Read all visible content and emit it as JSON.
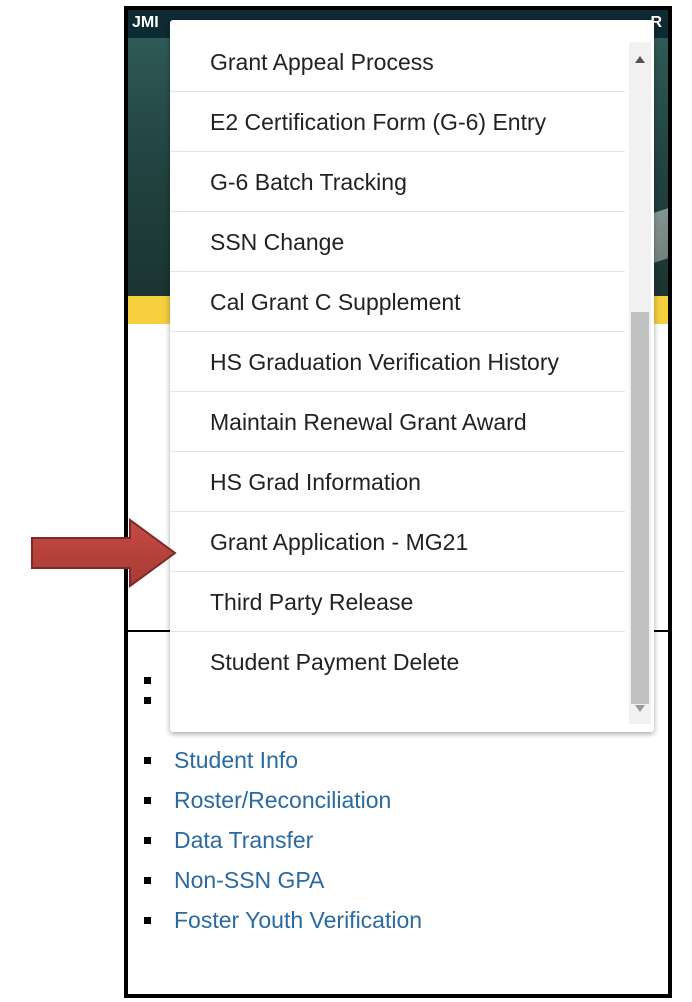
{
  "topbar": {
    "left_text": "JMI",
    "right_text": "R"
  },
  "dropdown": {
    "items": [
      "Grant Appeal Process",
      "E2 Certification Form (G-6) Entry",
      "G-6 Batch Tracking",
      "SSN Change",
      "Cal Grant C Supplement",
      "HS Graduation Verification History",
      "Maintain Renewal Grant Award",
      "HS Grad Information",
      "Grant Application - MG21",
      "Third Party Release",
      "Student Payment Delete"
    ]
  },
  "nav_list": {
    "items": [
      "Student Info",
      "Roster/Reconciliation",
      "Data Transfer",
      "Non-SSN GPA",
      "Foster Youth Verification"
    ]
  },
  "colors": {
    "link": "#2a6aa0",
    "banner": "#264b48",
    "accent_yellow": "#f5cf3e",
    "arrow": "#b8413c"
  }
}
